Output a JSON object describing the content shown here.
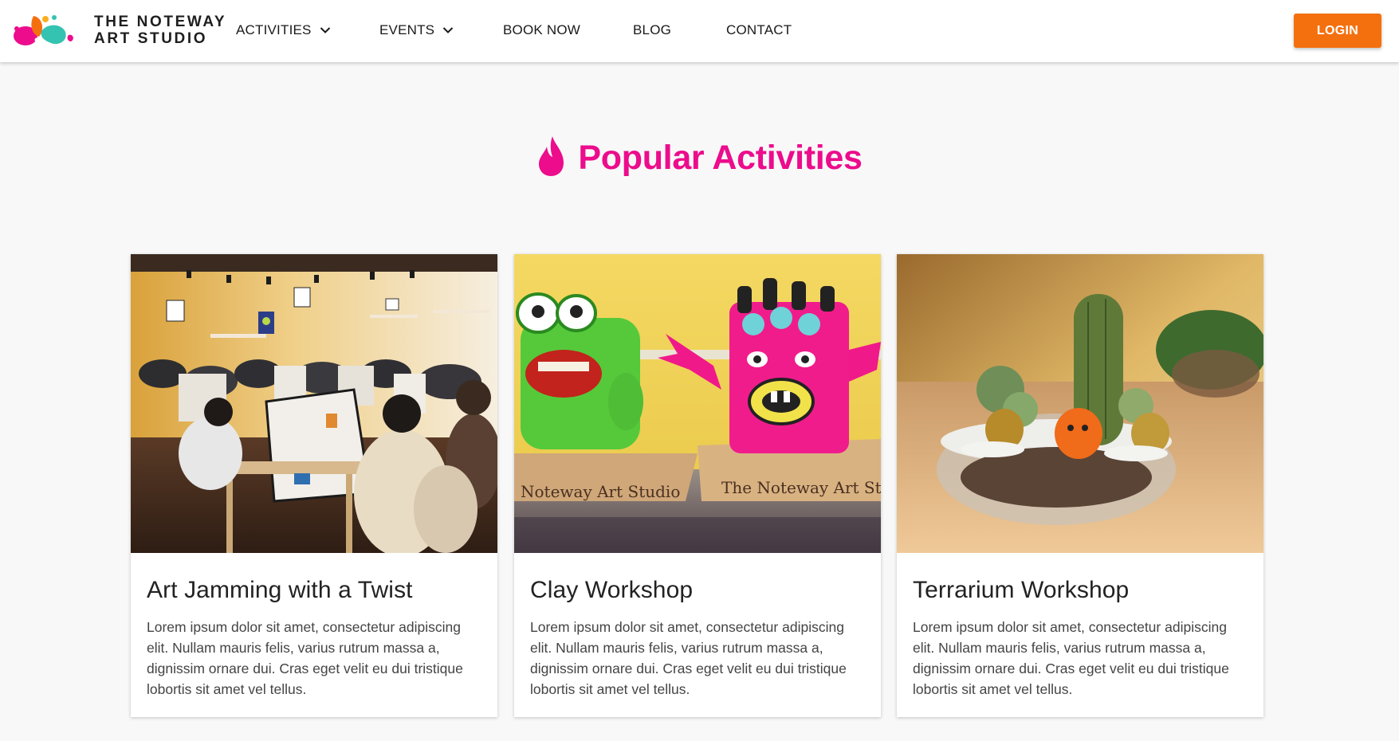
{
  "brand": {
    "line1": "THE NOTEWAY",
    "line2": "ART STUDIO",
    "colors": {
      "pink": "#ec0c8c",
      "orange": "#f4700f",
      "teal": "#35c3b1"
    }
  },
  "nav": {
    "items": [
      {
        "label": "ACTIVITIES",
        "dropdown": true,
        "icon": "chevron-down-icon"
      },
      {
        "label": "EVENTS",
        "dropdown": true,
        "icon": "chevron-down-icon"
      },
      {
        "label": "BOOK NOW"
      },
      {
        "label": "BLOG"
      },
      {
        "label": "CONTACT"
      }
    ],
    "login_label": "LOGIN"
  },
  "section": {
    "icon": "flame-icon",
    "title": "Popular Activities",
    "accent_color": "#ec0c8c"
  },
  "cards": [
    {
      "title": "Art Jamming with a Twist",
      "text": "Lorem ipsum dolor sit amet, consectetur adipiscing elit. Nullam mauris felis, varius rutrum massa a, dignissim ornare dui. Cras eget velit eu dui tristique lobortis sit amet vel tellus.",
      "image": "art-jamming-class-photo"
    },
    {
      "title": "Clay Workshop",
      "text": "Lorem ipsum dolor sit amet, consectetur adipiscing elit. Nullam mauris felis, varius rutrum massa a, dignissim ornare dui. Cras eget velit eu dui tristique lobortis sit amet vel tellus.",
      "image": "clay-monsters-photo",
      "image_caption_left": "Noteway Art Studio",
      "image_caption_right": "The Noteway Art Studio"
    },
    {
      "title": "Terrarium Workshop",
      "text": "Lorem ipsum dolor sit amet, consectetur adipiscing elit. Nullam mauris felis, varius rutrum massa a, dignissim ornare dui. Cras eget velit eu dui tristique lobortis sit amet vel tellus.",
      "image": "terrarium-bowl-photo"
    }
  ],
  "theme": {
    "login_button": "#f4700f",
    "page_background": "#f8f8f8"
  }
}
